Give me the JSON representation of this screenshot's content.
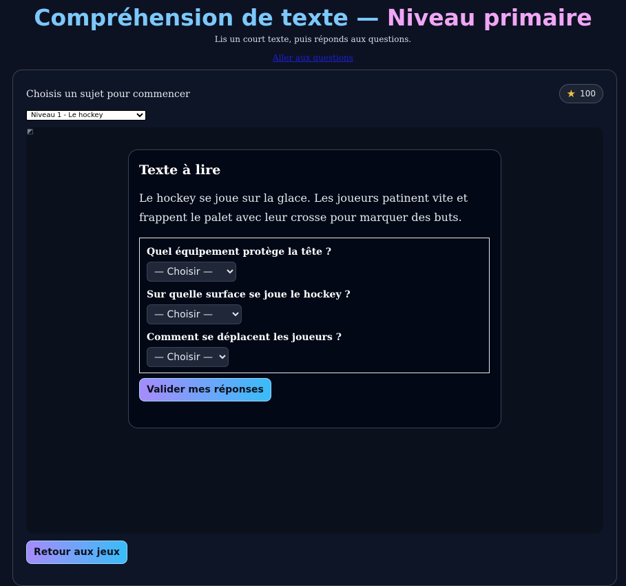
{
  "header": {
    "title_part1": "Compréhension de texte — ",
    "title_part2": "Niveau primaire",
    "subtitle": "Lis un court texte, puis réponds aux questions.",
    "skip_link": "Aller aux questions"
  },
  "card": {
    "topic_label": "Choisis un sujet pour commencer",
    "score": "100",
    "score_icon": "star-icon",
    "level_select": {
      "selected": "Niveau 1 - Le hockey"
    }
  },
  "reading": {
    "title": "Texte à lire",
    "passage": "Le hockey se joue sur la glace. Les joueurs patinent vite et frappent le palet avec leur crosse pour marquer des buts.",
    "questions": [
      {
        "label": "Quel équipement protège la tête ?",
        "selected": "— Choisir —"
      },
      {
        "label": "Sur quelle surface se joue le hockey ?",
        "selected": "— Choisir —"
      },
      {
        "label": "Comment se déplacent les joueurs ?",
        "selected": "— Choisir —"
      }
    ],
    "validate_label": "Valider mes réponses"
  },
  "footer": {
    "back_label": "Retour aux jeux"
  },
  "colors": {
    "background": "#0c1222",
    "title_blue": "#7cc8fb",
    "title_pink": "#f0a6f5",
    "gradient_start": "#a78bfa",
    "gradient_end": "#38bdf8",
    "star": "#f6c343"
  }
}
